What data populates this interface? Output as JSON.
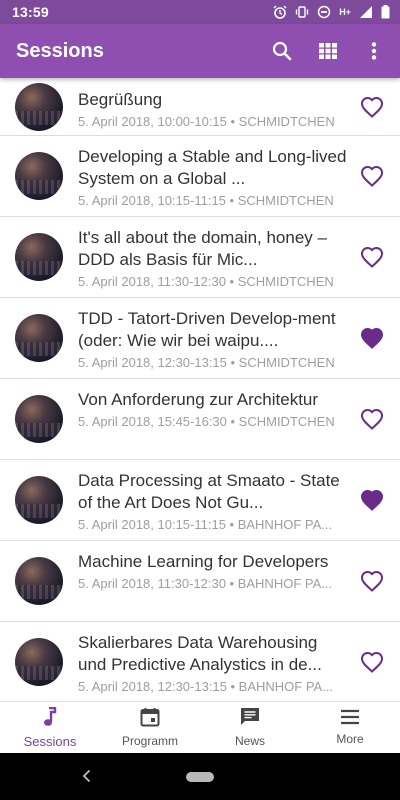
{
  "status_bar": {
    "time": "13:59",
    "network_label": "H+"
  },
  "app_bar": {
    "title": "Sessions",
    "actions": [
      "search-icon",
      "grid-view-icon",
      "more-vert-icon"
    ]
  },
  "colors": {
    "primary": "#8e4fb0",
    "status_bar": "#7e4a9c",
    "accent": "#7e3f9e",
    "favorite": "#6a2c8a"
  },
  "sessions": [
    {
      "title": "Begrüßung",
      "meta": "5. April 2018,  10:00-10:15 • SCHMIDTCHEN",
      "favorite": false
    },
    {
      "title": "Developing a Stable and Long-lived System on a Global ...",
      "meta": "5. April 2018,  10:15-11:15 • SCHMIDTCHEN",
      "favorite": false
    },
    {
      "title": "It's all about the domain, honey – DDD als Basis für Mic...",
      "meta": "5. April 2018,  11:30-12:30 • SCHMIDTCHEN",
      "favorite": false
    },
    {
      "title": "TDD - Tatort-Driven Develop-ment (oder: Wie wir bei waipu....",
      "meta": "5. April 2018,  12:30-13:15 • SCHMIDTCHEN",
      "favorite": true
    },
    {
      "title": "Von Anforderung zur Architektur",
      "meta": "5. April 2018,  15:45-16:30 • SCHMIDTCHEN",
      "favorite": false
    },
    {
      "title": "Data Processing at Smaato - State of the Art Does Not Gu...",
      "meta": "5. April 2018,  10:15-11:15 • BAHNHOF PA...",
      "favorite": true
    },
    {
      "title": "Machine Learning for Developers",
      "meta": "5. April 2018,  11:30-12:30 • BAHNHOF PA...",
      "favorite": false
    },
    {
      "title": "Skalierbares Data Warehousing und Predictive Analystics in de...",
      "meta": "5. April 2018,  12:30-13:15 • BAHNHOF PA...",
      "favorite": false
    }
  ],
  "bottom_nav": [
    {
      "label": "Sessions",
      "icon": "music-note-icon",
      "active": true
    },
    {
      "label": "Programm",
      "icon": "calendar-icon",
      "active": false
    },
    {
      "label": "News",
      "icon": "chat-message-icon",
      "active": false
    },
    {
      "label": "More",
      "icon": "menu-icon",
      "active": false
    }
  ]
}
